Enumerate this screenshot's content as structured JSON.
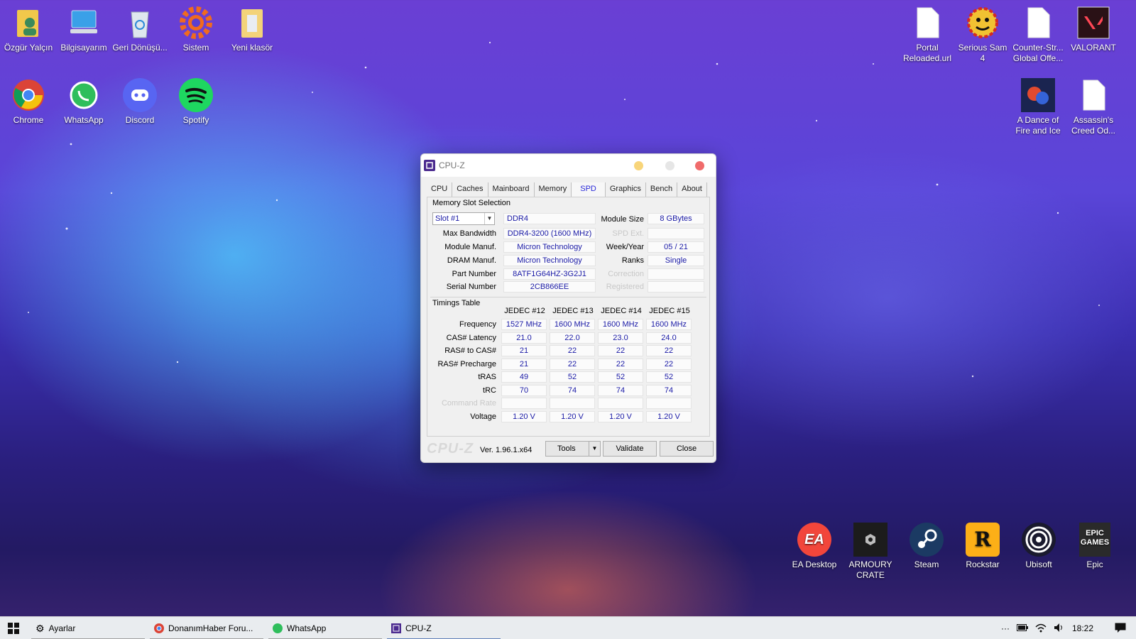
{
  "desktop": {
    "icons_top_left": [
      {
        "label": "Özgür Yalçın",
        "icon": "user-folder-icon"
      },
      {
        "label": "Bilgisayarım",
        "icon": "computer-icon"
      },
      {
        "label": "Geri Dönüşü...",
        "icon": "recycle-bin-icon"
      },
      {
        "label": "Sistem",
        "icon": "gear-icon"
      },
      {
        "label": "Yeni klasör",
        "icon": "folder-icon"
      }
    ],
    "icons_second_row": [
      {
        "label": "Chrome",
        "icon": "chrome-icon"
      },
      {
        "label": "WhatsApp",
        "icon": "whatsapp-icon"
      },
      {
        "label": "Discord",
        "icon": "discord-icon"
      },
      {
        "label": "Spotify",
        "icon": "spotify-icon"
      }
    ],
    "icons_top_right": [
      {
        "label": "Portal Reloaded.url",
        "icon": "file-icon"
      },
      {
        "label": "Serious Sam 4",
        "icon": "serious-sam-icon"
      },
      {
        "label": "Counter-Str... Global Offe...",
        "icon": "file-icon"
      },
      {
        "label": "VALORANT",
        "icon": "valorant-icon"
      }
    ],
    "icons_right_second_row": [
      {
        "label": "A Dance of Fire and Ice",
        "icon": "adofai-icon"
      },
      {
        "label": "Assassin's Creed Od...",
        "icon": "file-icon"
      }
    ],
    "icons_bottom_right": [
      {
        "label": "EA Desktop",
        "icon": "ea-icon",
        "glyph_text": "EA"
      },
      {
        "label": "ARMOURY CRATE",
        "icon": "armoury-crate-icon"
      },
      {
        "label": "Steam",
        "icon": "steam-icon"
      },
      {
        "label": "Rockstar",
        "icon": "rockstar-icon",
        "glyph_text": "R"
      },
      {
        "label": "Ubisoft",
        "icon": "ubisoft-icon"
      },
      {
        "label": "Epic",
        "icon": "epic-icon",
        "glyph_text": "EPIC GAMES"
      }
    ]
  },
  "cpuz": {
    "title": "CPU-Z",
    "tabs": [
      "CPU",
      "Caches",
      "Mainboard",
      "Memory",
      "SPD",
      "Graphics",
      "Bench",
      "About"
    ],
    "active_tab": "SPD",
    "memory_slot_selection_label": "Memory Slot Selection",
    "slot": "Slot #1",
    "type": "DDR4",
    "module_size_label": "Module Size",
    "module_size": "8 GBytes",
    "max_bandwidth_label": "Max Bandwidth",
    "max_bandwidth": "DDR4-3200 (1600 MHz)",
    "spd_ext_label": "SPD Ext.",
    "module_manuf_label": "Module Manuf.",
    "module_manuf": "Micron Technology",
    "week_year_label": "Week/Year",
    "week_year": "05 / 21",
    "dram_manuf_label": "DRAM Manuf.",
    "dram_manuf": "Micron Technology",
    "ranks_label": "Ranks",
    "ranks": "Single",
    "part_number_label": "Part Number",
    "part_number": "8ATF1G64HZ-3G2J1",
    "correction_label": "Correction",
    "serial_number_label": "Serial Number",
    "serial_number": "2CB866EE",
    "registered_label": "Registered",
    "timings_table_label": "Timings Table",
    "timing_columns": [
      "JEDEC #12",
      "JEDEC #13",
      "JEDEC #14",
      "JEDEC #15"
    ],
    "timing_rows": [
      {
        "label": "Frequency",
        "values": [
          "1527 MHz",
          "1600 MHz",
          "1600 MHz",
          "1600 MHz"
        ],
        "dim": false
      },
      {
        "label": "CAS# Latency",
        "values": [
          "21.0",
          "22.0",
          "23.0",
          "24.0"
        ],
        "dim": false
      },
      {
        "label": "RAS# to CAS#",
        "values": [
          "21",
          "22",
          "22",
          "22"
        ],
        "dim": false
      },
      {
        "label": "RAS# Precharge",
        "values": [
          "21",
          "22",
          "22",
          "22"
        ],
        "dim": false
      },
      {
        "label": "tRAS",
        "values": [
          "49",
          "52",
          "52",
          "52"
        ],
        "dim": false
      },
      {
        "label": "tRC",
        "values": [
          "70",
          "74",
          "74",
          "74"
        ],
        "dim": false
      },
      {
        "label": "Command Rate",
        "values": [
          "",
          "",
          "",
          ""
        ],
        "dim": true
      },
      {
        "label": "Voltage",
        "values": [
          "1.20 V",
          "1.20 V",
          "1.20 V",
          "1.20 V"
        ],
        "dim": false
      }
    ],
    "brand": "CPU-Z",
    "version": "Ver. 1.96.1.x64",
    "tools_label": "Tools",
    "validate_label": "Validate",
    "close_label": "Close"
  },
  "taskbar": {
    "items": [
      {
        "label": "Ayarlar",
        "icon": "settings-icon"
      },
      {
        "label": "DonanımHaber Foru...",
        "icon": "chrome-icon"
      },
      {
        "label": "WhatsApp",
        "icon": "whatsapp-icon"
      },
      {
        "label": "CPU-Z",
        "icon": "cpuz-icon"
      }
    ],
    "clock": "18:22",
    "overflow": "···"
  }
}
